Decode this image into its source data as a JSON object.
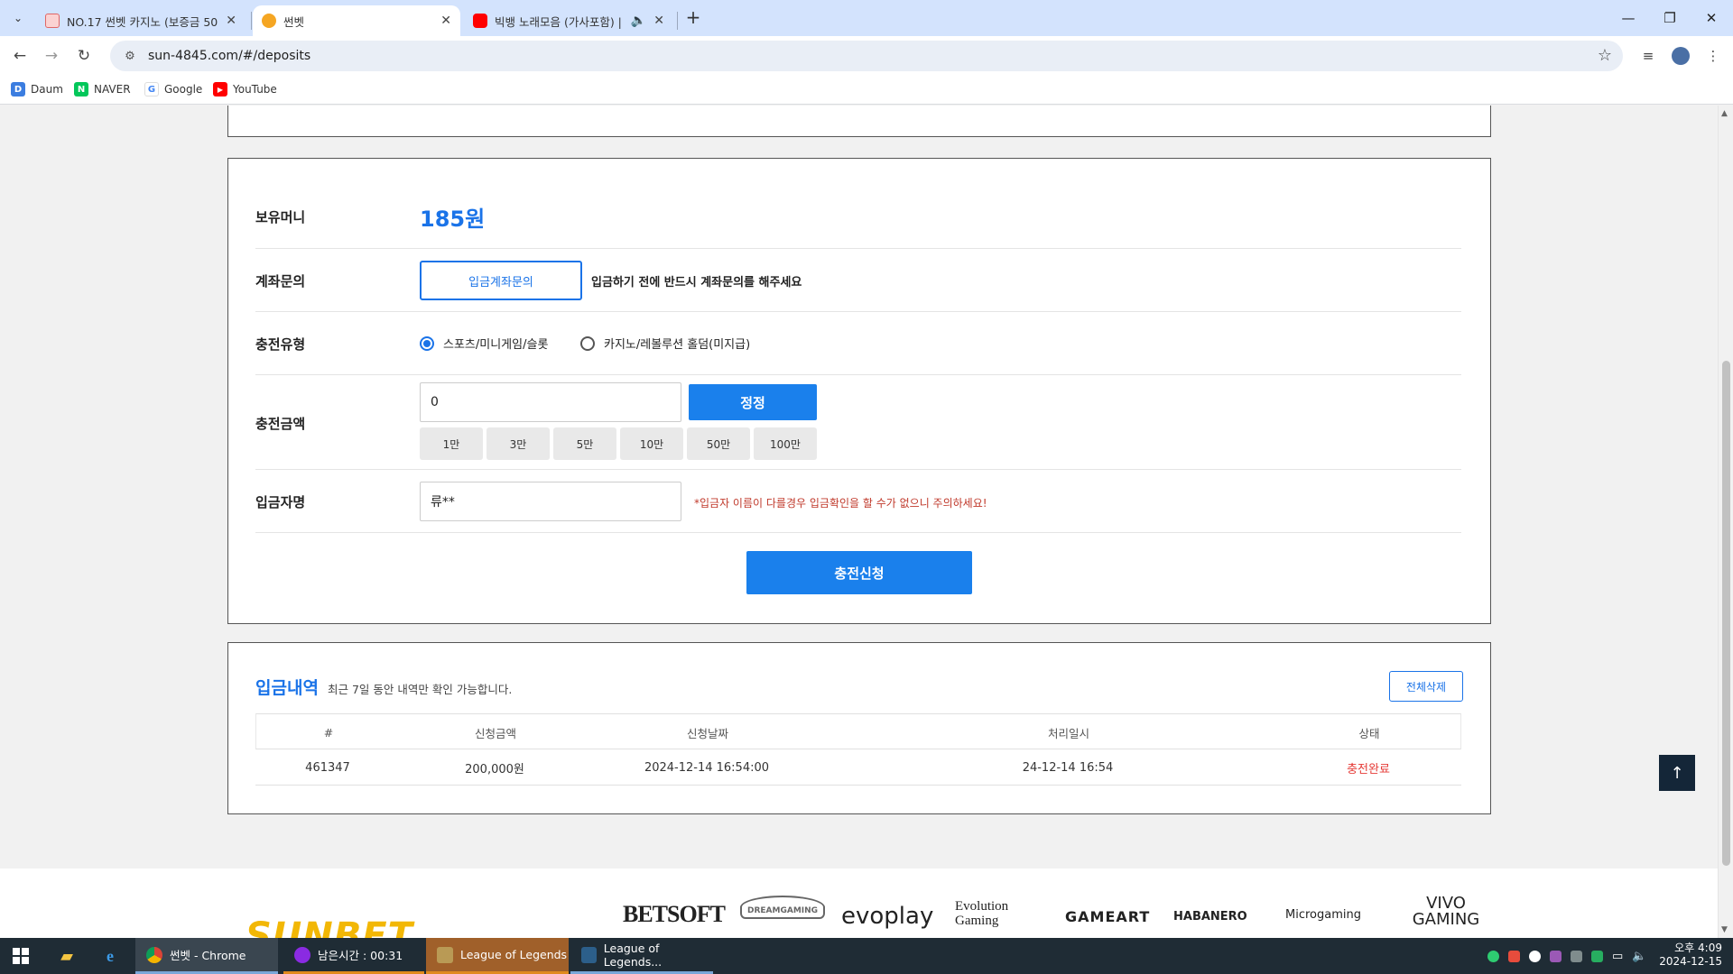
{
  "browser": {
    "tabs": [
      {
        "title": "NO.17 썬벳 카지노 (보증금 50",
        "active": false
      },
      {
        "title": "썬벳",
        "active": true
      },
      {
        "title": "빅뱅 노래모음 (가사포함) |",
        "active": false
      }
    ],
    "url": "sun-4845.com/#/deposits",
    "bookmarks": [
      "Daum",
      "NAVER",
      "Google",
      "YouTube"
    ]
  },
  "deposit": {
    "balance_label": "보유머니",
    "balance_value": "185원",
    "account_label": "계좌문의",
    "account_button": "입금계좌문의",
    "account_note": "입금하기 전에 반드시 계좌문의를 해주세요",
    "type_label": "충전유형",
    "type_options": [
      {
        "label": "스포츠/미니게임/슬롯",
        "selected": true
      },
      {
        "label": "카지노/레볼루션 홀덤(미지급)",
        "selected": false
      }
    ],
    "amount_label": "충전금액",
    "amount_value": "0",
    "amount_reset_button": "정정",
    "quick_amounts": [
      "1만",
      "3만",
      "5만",
      "10만",
      "50만",
      "100만"
    ],
    "depositor_label": "입금자명",
    "depositor_value": "류**",
    "depositor_warning": "*입금자 이름이 다를경우 입금확인을 할 수가 없으니 주의하세요!",
    "submit_button": "충전신청"
  },
  "history": {
    "title": "입금내역",
    "subtitle": "최근 7일 동안 내역만 확인 가능합니다.",
    "delete_all_button": "전체삭제",
    "columns": [
      "#",
      "신청금액",
      "신청날짜",
      "처리일시",
      "상태"
    ],
    "rows": [
      {
        "id": "461347",
        "amount": "200,000원",
        "request_date": "2024-12-14 16:54:00",
        "processed": "24-12-14 16:54",
        "status": "충전완료"
      }
    ],
    "status_color": "#e53935"
  },
  "footer": {
    "brand": "SUNBET",
    "providers": [
      "BETSOFT",
      "DREAMGAMING",
      "evoplay",
      "Evolution Gaming",
      "GAMEART",
      "HABANERO",
      "Microgaming",
      "VIVO GAMING"
    ]
  },
  "taskbar": {
    "apps": [
      "썬벳 - Chrome",
      "남은시간 : 00:31",
      "League of Legends",
      "League of Legends..."
    ],
    "clock_time": "오후 4:09",
    "clock_date": "2024-12-15"
  },
  "colors": {
    "accent": "#1a73e8",
    "button_blue": "#1a80ec",
    "warning": "#c0392b"
  }
}
